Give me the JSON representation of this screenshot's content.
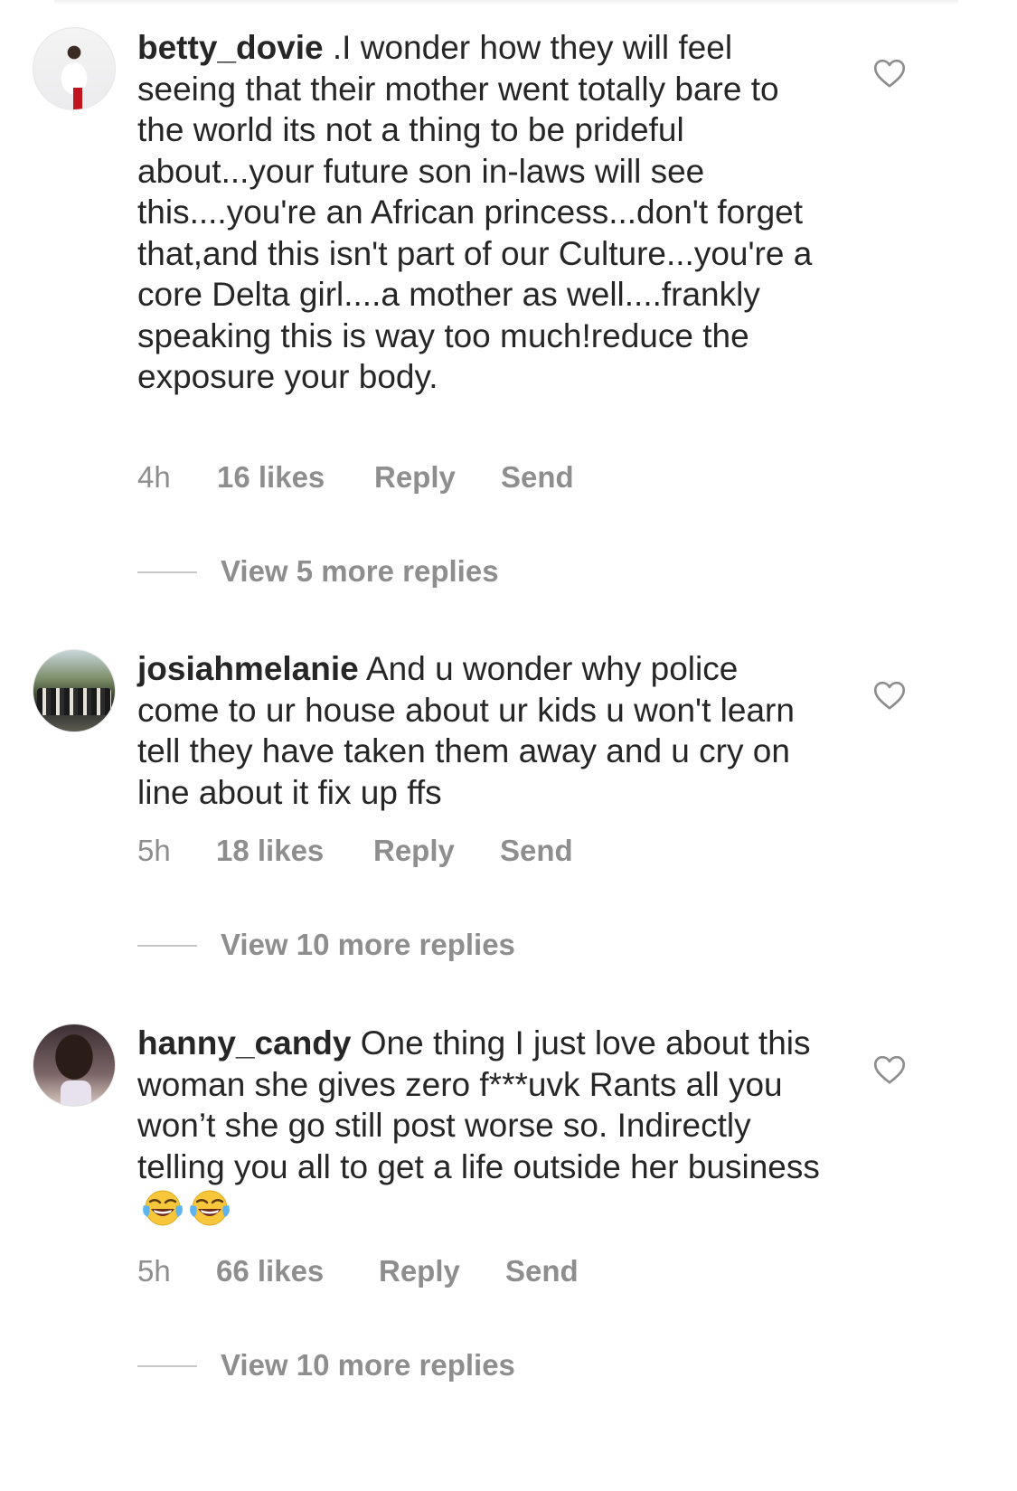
{
  "comments": [
    {
      "username": "betty_dovie",
      "text": " .I wonder how they will feel seeing that their mother went totally bare to the world its not a thing to be prideful about...your future son in-laws will see this....you're an African princess...don't forget that,and this isn't part of our Culture...you're a core Delta girl....a mother as well....frankly speaking this is way too much!reduce the exposure your body.",
      "time": "4h",
      "likes": "16 likes",
      "reply": "Reply",
      "send": "Send",
      "view_replies": "View 5 more replies"
    },
    {
      "username": "josiahmelanie",
      "text": " And u wonder why police come to ur house about ur kids u won't learn tell they have taken them away and u cry on line about it fix up ffs",
      "time": "5h",
      "likes": "18 likes",
      "reply": "Reply",
      "send": "Send",
      "view_replies": "View 10 more replies"
    },
    {
      "username": "hanny_candy",
      "text": " One thing I just love about this woman she gives zero f***uvk Rants all you won’t she go still post worse so. Indirectly telling you all to get a life outside her business ",
      "emoji": "face-with-tears-of-joy x2",
      "time": "5h",
      "likes": "66 likes",
      "reply": "Reply",
      "send": "Send",
      "view_replies": "View 10 more replies"
    }
  ],
  "icons": {
    "like": "heart-outline-icon",
    "emoji": "face-with-tears-of-joy"
  },
  "colors": {
    "text": "#262626",
    "secondary": "#8e8e8e",
    "divider": "#c7c7c7"
  }
}
